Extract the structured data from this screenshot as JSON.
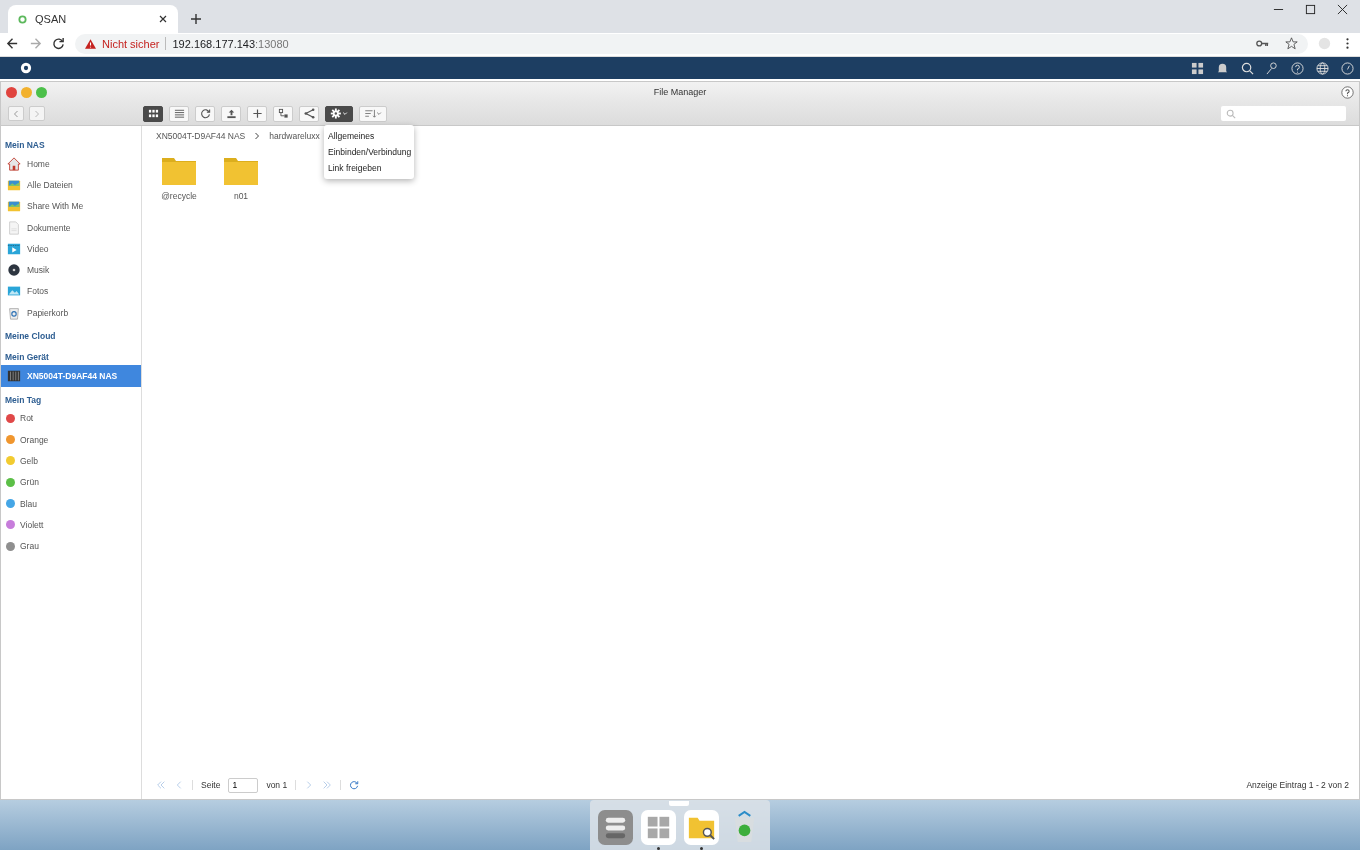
{
  "browser": {
    "tab_title": "QSAN",
    "security": "Nicht sicher",
    "url_host": "192.168.177.143",
    "url_port": ":13080"
  },
  "window": {
    "title": "File Manager"
  },
  "view_buttons": [
    {
      "kind": "grid",
      "selected": true
    },
    {
      "kind": "list",
      "selected": false
    }
  ],
  "settings_menu": {
    "open": true,
    "items": [
      "Allgemeines",
      "Einbinden/Verbindung",
      "Link freigeben"
    ]
  },
  "breadcrumb": [
    "XN5004T-D9AF44 NAS",
    "hardwareluxx"
  ],
  "sidebar": [
    {
      "title": "Mein NAS",
      "items": [
        {
          "kind": "home",
          "label": "Home",
          "selected": false
        },
        {
          "kind": "files",
          "label": "Alle Dateien",
          "selected": false
        },
        {
          "kind": "share",
          "label": "Share With Me",
          "selected": false
        },
        {
          "kind": "docs",
          "label": "Dokumente",
          "selected": false
        },
        {
          "kind": "video",
          "label": "Video",
          "selected": false
        },
        {
          "kind": "music",
          "label": "Musik",
          "selected": false
        },
        {
          "kind": "photos",
          "label": "Fotos",
          "selected": false
        },
        {
          "kind": "trash",
          "label": "Papierkorb",
          "selected": false
        }
      ]
    },
    {
      "title": "Meine Cloud"
    },
    {
      "title": "Mein Gerät",
      "items": [
        {
          "kind": "nas",
          "label": "XN5004T-D9AF44 NAS",
          "selected": true
        }
      ]
    },
    {
      "title": "Mein Tag",
      "items": [
        {
          "kind": "tag",
          "label": "Rot",
          "color": "#e04848",
          "selected": false
        },
        {
          "kind": "tag",
          "label": "Orange",
          "color": "#f0962e",
          "selected": false
        },
        {
          "kind": "tag",
          "label": "Gelb",
          "color": "#f2cb30",
          "selected": false
        },
        {
          "kind": "tag",
          "label": "Grün",
          "color": "#5cbf47",
          "selected": false
        },
        {
          "kind": "tag",
          "label": "Blau",
          "color": "#45a6e6",
          "selected": false
        },
        {
          "kind": "tag",
          "label": "Violett",
          "color": "#c77ddb",
          "selected": false
        },
        {
          "kind": "tag",
          "label": "Grau",
          "color": "#8f8f8f",
          "selected": false
        }
      ]
    }
  ],
  "files": [
    {
      "name": "@recycle"
    },
    {
      "name": "n01"
    }
  ],
  "pager": {
    "page_label": "Seite",
    "page": "1",
    "of": "von 1",
    "summary": "Anzeige Eintrag 1 - 2 von 2"
  },
  "dock": [
    {
      "kind": "control",
      "running": false
    },
    {
      "kind": "apps",
      "running": true
    },
    {
      "kind": "filemanager",
      "running": true
    },
    {
      "kind": "recycle",
      "running": false
    }
  ]
}
